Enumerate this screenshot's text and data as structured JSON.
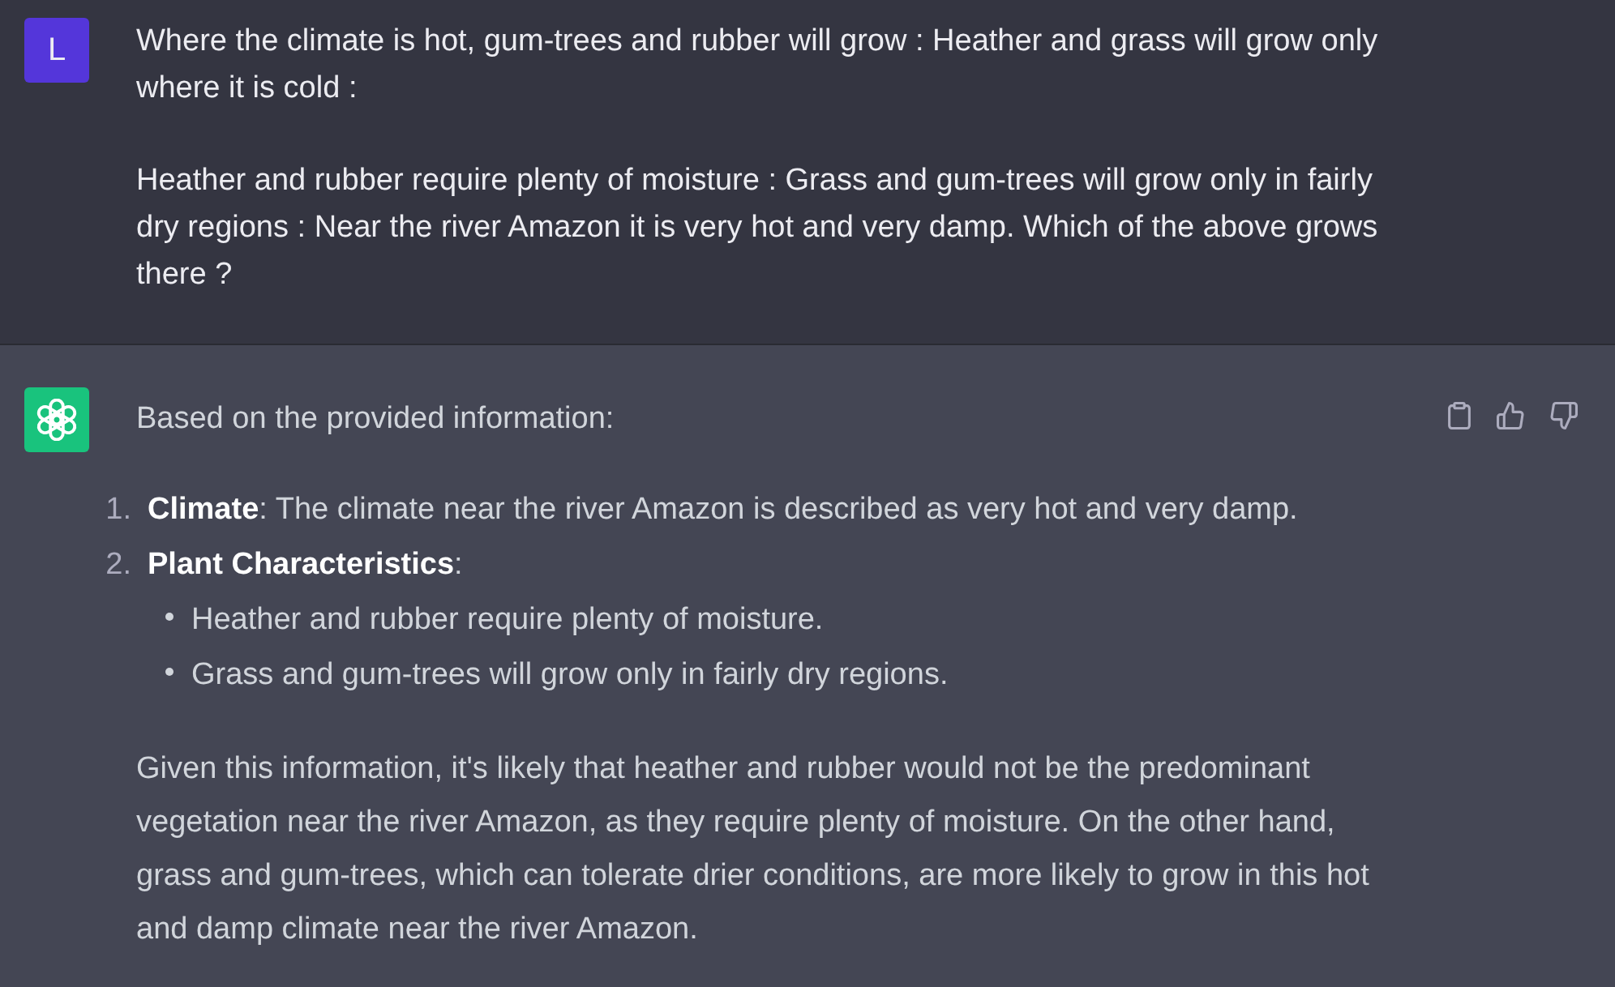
{
  "user_message": {
    "avatar_letter": "L",
    "paragraphs": [
      "Where the climate is hot, gum-trees and rubber will grow : Heather and grass will grow only where it is cold :",
      "Heather and rubber require plenty of moisture : Grass and gum-trees will grow only in fairly dry regions : Near the river Amazon it is very hot and very damp. Which of the above grows there ?"
    ]
  },
  "assistant_message": {
    "intro": "Based on the provided information:",
    "list": [
      {
        "number": "1.",
        "text": "**Climate**: The climate near the river Amazon is described as very hot and very damp."
      },
      {
        "number": "2.",
        "text": "**Plant Characteristics**:",
        "children": [
          {
            "text": "Heather and rubber require plenty of moisture."
          },
          {
            "text": "Grass and gum-trees will grow only in fairly dry regions."
          }
        ]
      }
    ],
    "paragraphs": [
      "Given this information, it's likely that heather and rubber would not be the predominant vegetation near the river Amazon, as they require plenty of moisture. On the other hand, grass and gum-trees, which can tolerate drier conditions, are more likely to grow in this hot and damp climate near the river Amazon."
    ]
  }
}
